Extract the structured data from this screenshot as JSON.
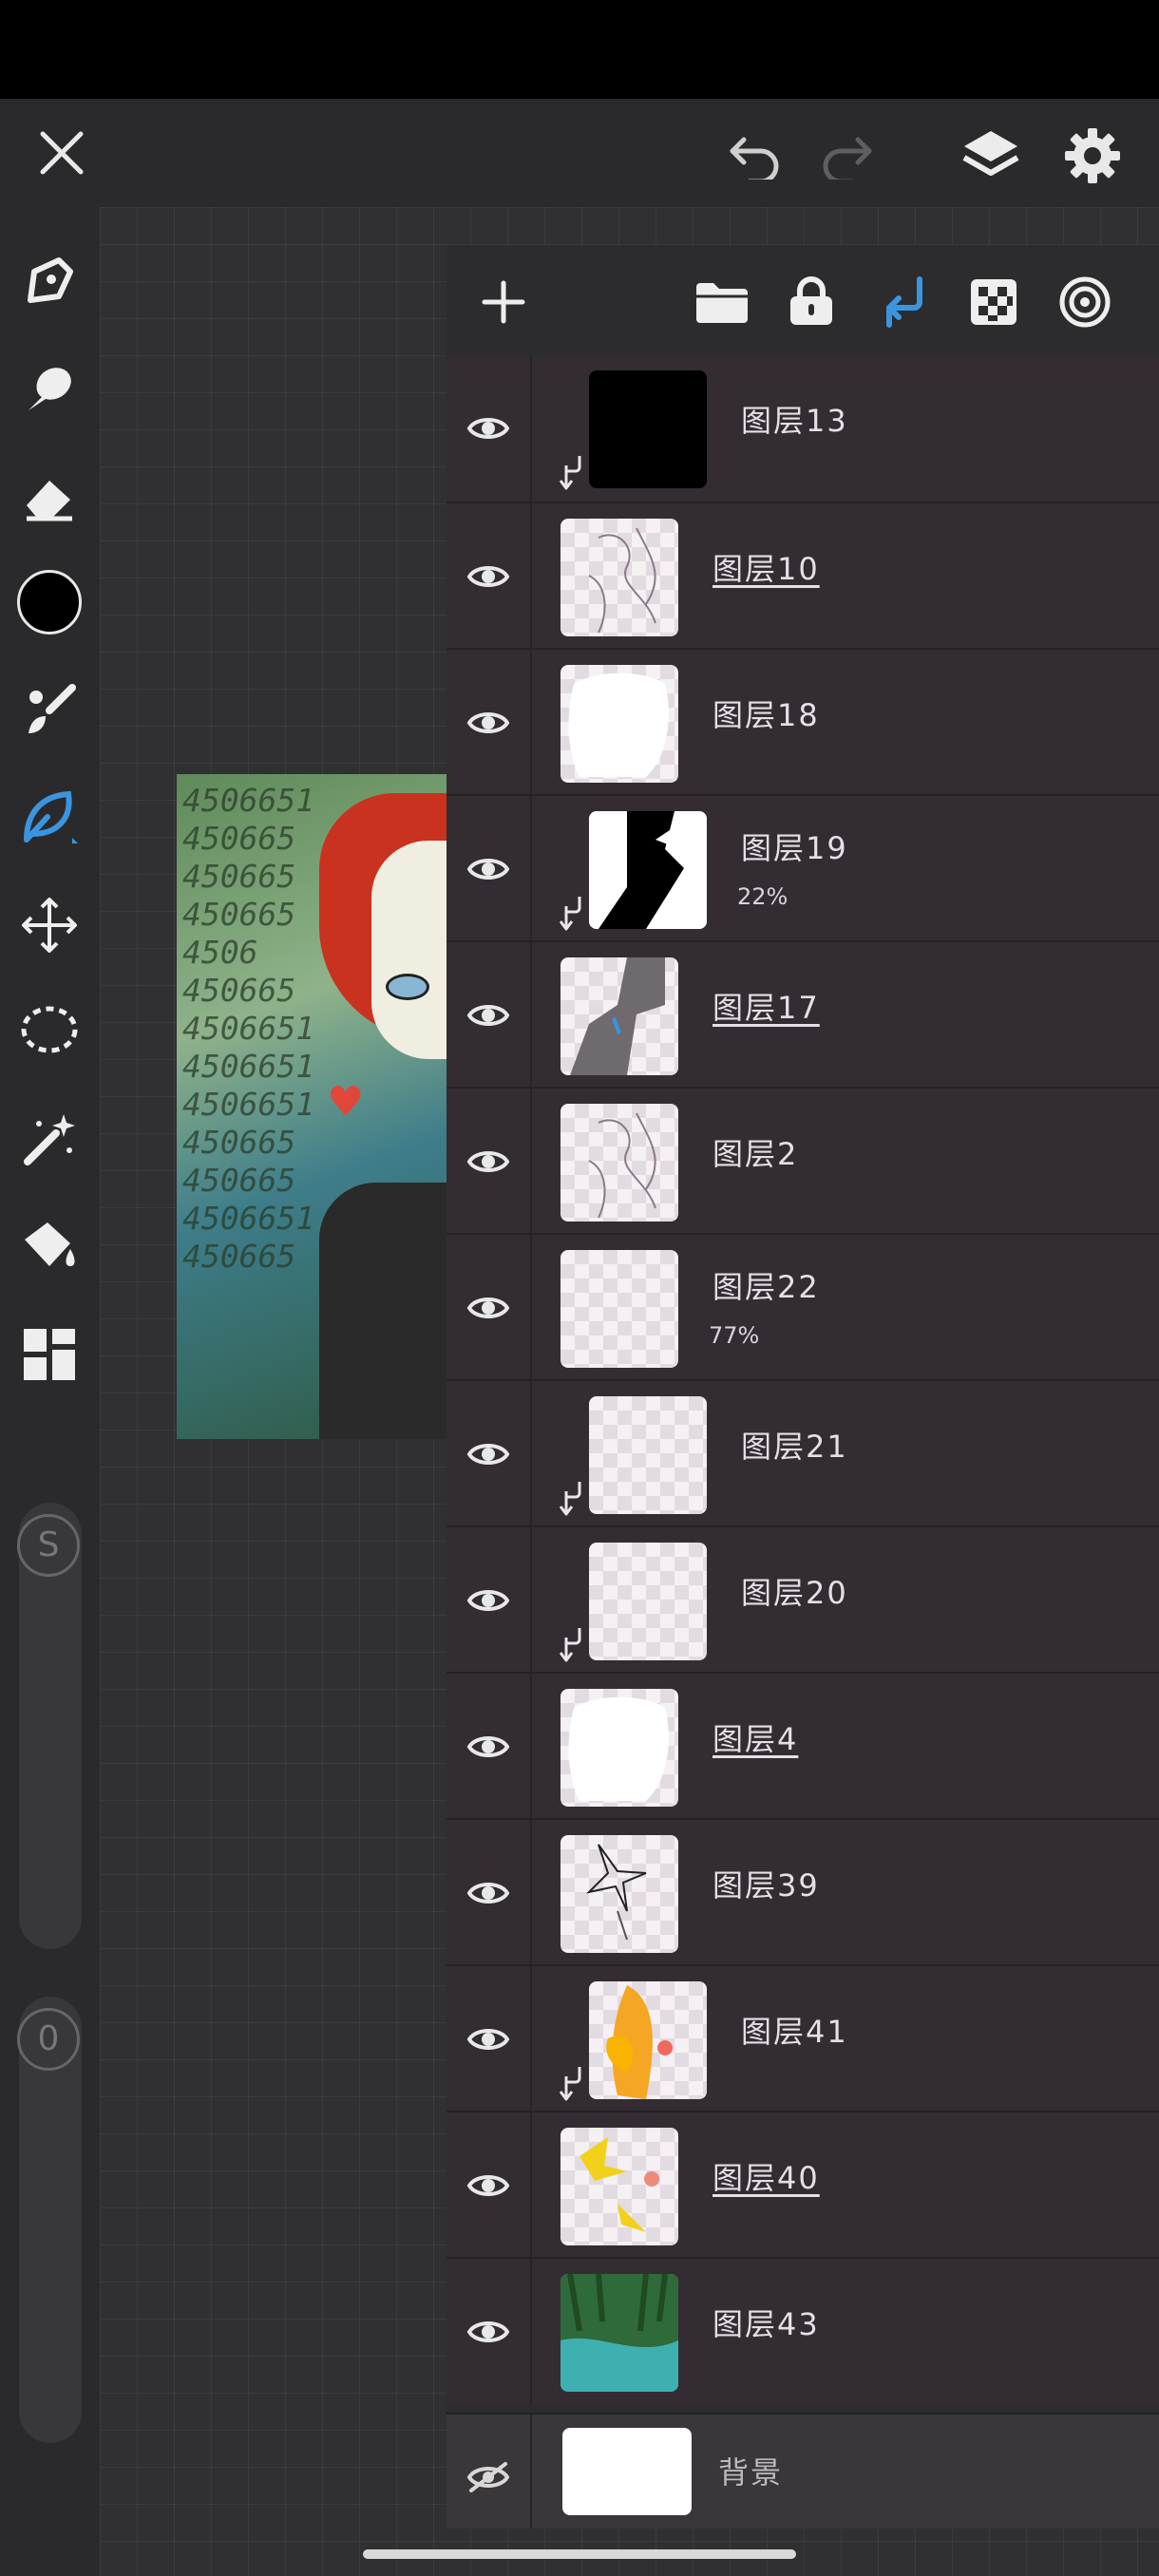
{
  "colors": {
    "accent": "#3a95e0",
    "current_color": "#000000",
    "panel_bg": "#2e2b30",
    "icon": "#e8e8e8"
  },
  "topbar": {
    "close_icon": "close-icon",
    "undo_icon": "undo-icon",
    "redo_icon": "redo-icon",
    "layers_icon": "layers-icon",
    "settings_icon": "gear-icon"
  },
  "toolbar": {
    "tools": [
      "pen-tool",
      "smudge-tool",
      "eraser-tool",
      "color-swatch",
      "brush-tool",
      "blend-tool",
      "transform-tool",
      "lasso-tool",
      "magic-wand-tool",
      "fill-tool",
      "more-tools"
    ],
    "active_tool": "blend-tool",
    "size_label": "S",
    "opacity_label": "0"
  },
  "artwork": {
    "digits_text": "4506651\n450665\n450665\n450665\n4506\n450665\n4506651\n4506651\n4506651\n450665\n450665\n4506651\n450665"
  },
  "layers_toolbar": {
    "icons": [
      "add-layer-icon",
      "folder-icon",
      "lock-icon",
      "clipping-mask-icon",
      "transparency-lock-icon",
      "layer-effects-icon"
    ],
    "active": "clipping-mask-icon"
  },
  "layers": [
    {
      "name": "图层13",
      "visible": true,
      "clipped": true,
      "underline": false,
      "thumb": "black"
    },
    {
      "name": "图层10",
      "visible": true,
      "clipped": false,
      "underline": true,
      "thumb": "sketch"
    },
    {
      "name": "图层18",
      "visible": true,
      "clipped": false,
      "underline": false,
      "thumb": "white-shape"
    },
    {
      "name": "图层19",
      "opacity": "22%",
      "visible": true,
      "clipped": true,
      "underline": false,
      "thumb": "ink"
    },
    {
      "name": "图层17",
      "visible": true,
      "clipped": false,
      "underline": true,
      "thumb": "gray-shape"
    },
    {
      "name": "图层2",
      "visible": true,
      "clipped": false,
      "underline": false,
      "thumb": "sketch"
    },
    {
      "name": "图层22",
      "opacity": "77%",
      "visible": true,
      "clipped": false,
      "underline": false,
      "thumb": "empty"
    },
    {
      "name": "图层21",
      "visible": true,
      "clipped": true,
      "underline": false,
      "thumb": "empty"
    },
    {
      "name": "图层20",
      "visible": true,
      "clipped": true,
      "underline": false,
      "thumb": "empty"
    },
    {
      "name": "图层4",
      "visible": true,
      "clipped": false,
      "underline": true,
      "thumb": "white-shape"
    },
    {
      "name": "图层39",
      "visible": true,
      "clipped": false,
      "underline": false,
      "thumb": "star-sketch"
    },
    {
      "name": "图层41",
      "visible": true,
      "clipped": true,
      "underline": false,
      "thumb": "orange"
    },
    {
      "name": "图层40",
      "visible": true,
      "clipped": false,
      "underline": true,
      "thumb": "yellow"
    },
    {
      "name": "图层43",
      "visible": true,
      "clipped": false,
      "underline": false,
      "thumb": "forest"
    }
  ],
  "background_layer": {
    "name": "背景",
    "visible": false
  }
}
